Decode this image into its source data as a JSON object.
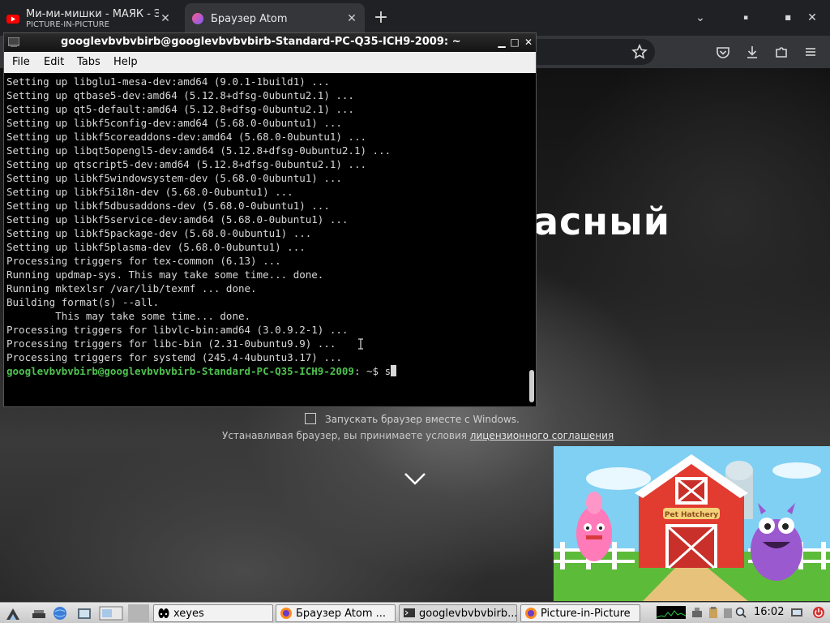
{
  "browser": {
    "tabs": [
      {
        "title": "Ми-ми-мишки - МАЯК - Э",
        "subtitle": "PICTURE-IN-PICTURE",
        "close": "✕"
      },
      {
        "title": "Браузер Atom",
        "close": "✕"
      }
    ],
    "new_tab": "+",
    "window_controls": {
      "list": "⌄",
      "minimize": "▪",
      "maximize": "■",
      "close": "✕"
    },
    "toolbar_icons": [
      "bookmark-star-icon",
      "pocket-icon",
      "download-icon",
      "extensions-icon",
      "menu-icon"
    ]
  },
  "page": {
    "headline": "асный",
    "startup_label": "Запускать браузер вместе с Windows.",
    "license_text": "Устанавливая браузер, вы принимаете условия ",
    "license_link": "лицензионного соглашения"
  },
  "terminal": {
    "title": "googlevbvbvbirb@googlevbvbvbirb-Standard-PC-Q35-ICH9-2009: ~",
    "menu": [
      "File",
      "Edit",
      "Tabs",
      "Help"
    ],
    "buttons": {
      "minimize": "▁",
      "maximize": "□",
      "close": "✕"
    },
    "output": "Setting up libglu1-mesa-dev:amd64 (9.0.1-1build1) ...\nSetting up qtbase5-dev:amd64 (5.12.8+dfsg-0ubuntu2.1) ...\nSetting up qt5-default:amd64 (5.12.8+dfsg-0ubuntu2.1) ...\nSetting up libkf5config-dev:amd64 (5.68.0-0ubuntu1) ...\nSetting up libkf5coreaddons-dev:amd64 (5.68.0-0ubuntu1) ...\nSetting up libqt5opengl5-dev:amd64 (5.12.8+dfsg-0ubuntu2.1) ...\nSetting up qtscript5-dev:amd64 (5.12.8+dfsg-0ubuntu2.1) ...\nSetting up libkf5windowsystem-dev (5.68.0-0ubuntu1) ...\nSetting up libkf5i18n-dev (5.68.0-0ubuntu1) ...\nSetting up libkf5dbusaddons-dev (5.68.0-0ubuntu1) ...\nSetting up libkf5service-dev:amd64 (5.68.0-0ubuntu1) ...\nSetting up libkf5package-dev (5.68.0-0ubuntu1) ...\nSetting up libkf5plasma-dev (5.68.0-0ubuntu1) ...\nProcessing triggers for tex-common (6.13) ...\nRunning updmap-sys. This may take some time... done.\nRunning mktexlsr /var/lib/texmf ... done.\nBuilding format(s) --all.\n        This may take some time... done.\nProcessing triggers for libvlc-bin:amd64 (3.0.9.2-1) ...\nProcessing triggers for libc-bin (2.31-0ubuntu9.9) ...\nProcessing triggers for systemd (245.4-4ubuntu3.17) ...",
    "prompt_user": "googlevbvbvbirb@googlevbvbvbirb-Standard-PC-Q35-ICH9-2009",
    "prompt_sep": ": ~",
    "prompt_symbol": "$ ",
    "command": "s"
  },
  "pip": {
    "barn_sign": "Pet Hatchery"
  },
  "taskbar": {
    "launchers": [
      "start-icon",
      "desktop-icon",
      "browser-globe-icon",
      "file-manager-icon",
      "screen-icon"
    ],
    "tasks": [
      {
        "label": "xeyes",
        "icon": "xeyes-icon"
      },
      {
        "label": "Браузер Atom ...",
        "icon": "firefox-icon"
      },
      {
        "label": "googlevbvbvbirb...",
        "icon": "terminal-icon"
      },
      {
        "label": "Picture-in-Picture",
        "icon": "firefox-icon"
      }
    ],
    "clock": "16:02"
  },
  "colors": {
    "prompt_green": "#4ec24e",
    "terminal_bg": "#000000",
    "tabbar_bg": "#202124",
    "toolbar_bg": "#35363a"
  }
}
